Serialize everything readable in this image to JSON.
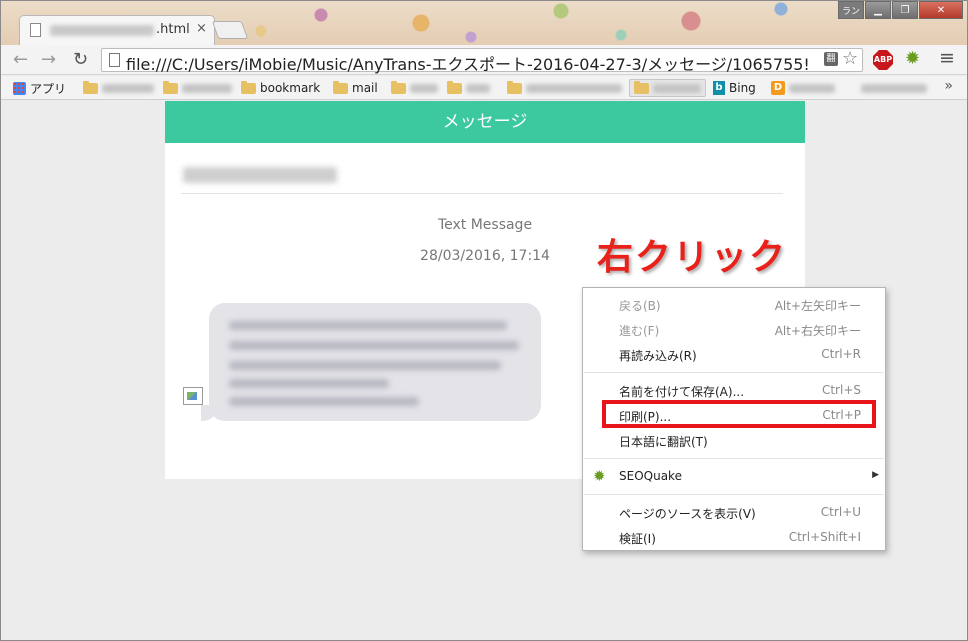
{
  "browser": {
    "tab_ext": ".html",
    "tab_close": "×",
    "window": {
      "lang": "ラン",
      "minimize": "▁",
      "maximize": "❐",
      "close": "✕"
    },
    "url": "file:///C:/Users/iMobie/Music/AnyTrans-エクスポート-2016-04-27-3/メッセージ/1065755!",
    "nav": {
      "back": "←",
      "forward": "→",
      "reload": "↻"
    },
    "star": "☆",
    "abp": "ABP",
    "menu": "≡",
    "seoquake_glyph": "✹"
  },
  "bookmarks": {
    "apps": "アプリ",
    "bookmark": "bookmark",
    "mail": "mail",
    "bing": "Bing",
    "more": "»"
  },
  "page": {
    "header": "メッセージ",
    "msg_type": "Text Message",
    "msg_time": "28/03/2016, 17:14"
  },
  "annotation": "右クリック",
  "context_menu": {
    "items": [
      {
        "label": "戻る(B)",
        "shortcut": "Alt+左矢印キー",
        "disabled": true
      },
      {
        "label": "進む(F)",
        "shortcut": "Alt+右矢印キー",
        "disabled": true
      },
      {
        "label": "再読み込み(R)",
        "shortcut": "Ctrl+R"
      },
      {
        "label": "名前を付けて保存(A)...",
        "shortcut": "Ctrl+S"
      },
      {
        "label": "印刷(P)...",
        "shortcut": "Ctrl+P",
        "highlighted": true
      },
      {
        "label": "日本語に翻訳(T)",
        "shortcut": ""
      },
      {
        "label": "SEOQuake",
        "shortcut": "",
        "submenu": true
      },
      {
        "label": "ページのソースを表示(V)",
        "shortcut": "Ctrl+U"
      },
      {
        "label": "検証(I)",
        "shortcut": "Ctrl+Shift+I"
      }
    ],
    "submenu_arrow": "▶"
  },
  "colors": {
    "header": "#3dc9a0",
    "highlight": "#e8161b",
    "annotation": "#e8211a"
  }
}
